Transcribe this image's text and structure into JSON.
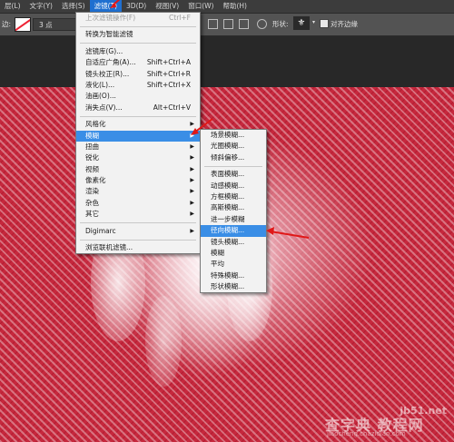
{
  "menubar": {
    "items": [
      "层(L)",
      "文字(Y)",
      "选择(S)",
      "滤镜(T)",
      "3D(D)",
      "视图(V)",
      "窗口(W)",
      "帮助(H)"
    ]
  },
  "options_bar": {
    "label_left": "边:",
    "size_value": "3 点",
    "shape_label": "形状:",
    "align_label": "对齐边缘"
  },
  "filter_menu": {
    "items": [
      {
        "label": "上次滤镜操作(F)",
        "shortcut": "Ctrl+F",
        "disabled": true
      },
      {
        "sep": true
      },
      {
        "label": "转换为智能滤镜"
      },
      {
        "sep": true
      },
      {
        "label": "滤镜库(G)..."
      },
      {
        "label": "自适应广角(A)...",
        "shortcut": "Shift+Ctrl+A"
      },
      {
        "label": "镜头校正(R)...",
        "shortcut": "Shift+Ctrl+R"
      },
      {
        "label": "液化(L)...",
        "shortcut": "Shift+Ctrl+X"
      },
      {
        "label": "油画(O)..."
      },
      {
        "label": "消失点(V)...",
        "shortcut": "Alt+Ctrl+V"
      },
      {
        "sep": true
      },
      {
        "label": "风格化",
        "submenu": true
      },
      {
        "label": "模糊",
        "submenu": true,
        "highlighted": true
      },
      {
        "label": "扭曲",
        "submenu": true
      },
      {
        "label": "锐化",
        "submenu": true
      },
      {
        "label": "视频",
        "submenu": true
      },
      {
        "label": "像素化",
        "submenu": true
      },
      {
        "label": "渲染",
        "submenu": true
      },
      {
        "label": "杂色",
        "submenu": true
      },
      {
        "label": "其它",
        "submenu": true
      },
      {
        "sep": true
      },
      {
        "label": "Digimarc",
        "submenu": true
      },
      {
        "sep": true
      },
      {
        "label": "浏览联机滤镜..."
      }
    ]
  },
  "blur_menu": {
    "items": [
      {
        "label": "场景模糊..."
      },
      {
        "label": "光圈模糊..."
      },
      {
        "label": "倾斜偏移..."
      },
      {
        "sep": true
      },
      {
        "label": "表面模糊..."
      },
      {
        "label": "动感模糊..."
      },
      {
        "label": "方框模糊..."
      },
      {
        "label": "高斯模糊..."
      },
      {
        "label": "进一步模糊"
      },
      {
        "label": "径向模糊...",
        "highlighted": true
      },
      {
        "label": "镜头模糊..."
      },
      {
        "label": "模糊"
      },
      {
        "label": "平均"
      },
      {
        "label": "特殊模糊..."
      },
      {
        "label": "形状模糊..."
      }
    ]
  },
  "watermark": {
    "top": "jb51.net",
    "middle": "查字典 教程网",
    "bottom": "jiaocheng.chazidian.com"
  },
  "colors": {
    "menu_highlight": "#3a8ee6",
    "canvas_red": "#c6283d",
    "annotation_arrow": "#e01818"
  }
}
